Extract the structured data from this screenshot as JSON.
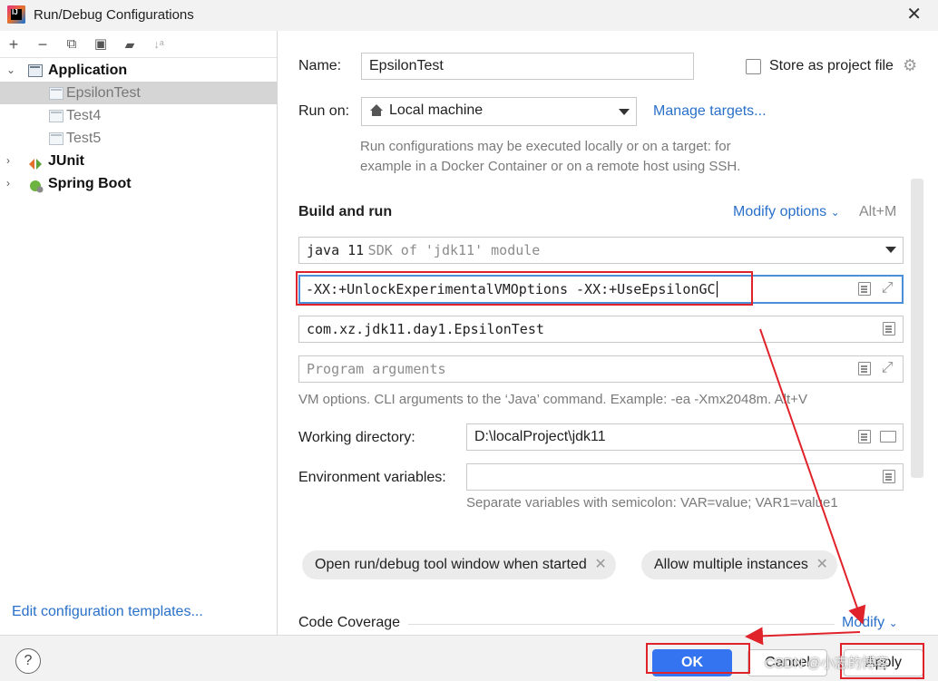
{
  "window": {
    "title": "Run/Debug Configurations",
    "close_glyph": "✕"
  },
  "toolbar": {
    "add": "+",
    "remove": "−",
    "copy": "⧉",
    "save": "▣",
    "folder": "▰",
    "sort": "↓ᵃ"
  },
  "tree": {
    "application": "Application",
    "epsilon": "EpsilonTest",
    "test4": "Test4",
    "test5": "Test5",
    "junit": "JUnit",
    "spring": "Spring Boot"
  },
  "edit_templates": "Edit configuration templates...",
  "name": {
    "label": "Name:",
    "value": "EpsilonTest"
  },
  "store_project_file": "Store as project file",
  "run_on": {
    "label": "Run on:",
    "value": "Local machine",
    "manage": "Manage targets..."
  },
  "run_hint_1": "Run configurations may be executed locally or on a target: for",
  "run_hint_2": "example in a Docker Container or on a remote host using SSH.",
  "build_run": {
    "title": "Build and run",
    "modify": "Modify options",
    "shortcut": "Alt+M"
  },
  "sdk": {
    "name": "java 11",
    "detail": "SDK of 'jdk11' module"
  },
  "vm_options": "-XX:+UnlockExperimentalVMOptions -XX:+UseEpsilonGC",
  "main_class": "com.xz.jdk11.day1.EpsilonTest",
  "program_args_placeholder": "Program arguments",
  "vm_hint": "VM options. CLI arguments to the ‘Java’ command. Example: -ea -Xmx2048m. Alt+V",
  "working_dir": {
    "label": "Working directory:",
    "value": "D:\\localProject\\jdk11"
  },
  "env_vars": {
    "label": "Environment variables:",
    "value": "",
    "hint": "Separate variables with semicolon: VAR=value; VAR1=value1"
  },
  "chips": {
    "open_tool": "Open run/debug tool window when started",
    "allow_multiple": "Allow multiple instances"
  },
  "code_coverage": {
    "label": "Code Coverage",
    "modify": "Modify"
  },
  "buttons": {
    "help": "?",
    "ok": "OK",
    "cancel": "Cancel",
    "apply": "Apply"
  },
  "watermark": "CSDN @小志的博客",
  "colors": {
    "accent": "#3574f0",
    "link": "#2970c9",
    "annotation": "#e0232a"
  }
}
